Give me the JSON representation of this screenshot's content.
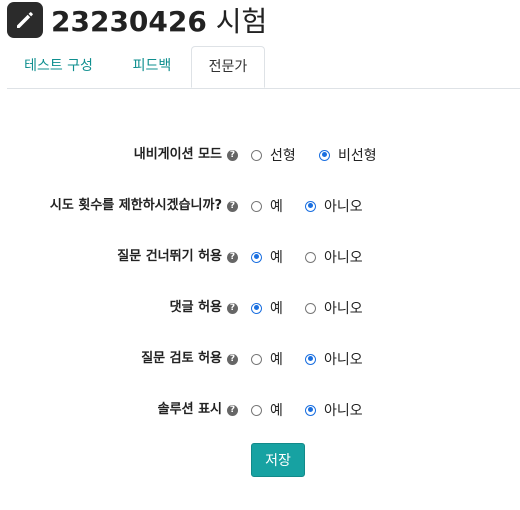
{
  "header": {
    "title_number": "23230426",
    "title_suffix": "시험"
  },
  "tabs": [
    {
      "label": "테스트 구성",
      "active": false
    },
    {
      "label": "피드백",
      "active": false
    },
    {
      "label": "전문가",
      "active": true
    }
  ],
  "help_glyph": "?",
  "settings": [
    {
      "label": "내비게이션 모드",
      "options": [
        {
          "label": "선형",
          "checked": false
        },
        {
          "label": "비선형",
          "checked": true
        }
      ]
    },
    {
      "label": "시도 횟수를 제한하시겠습니까?",
      "options": [
        {
          "label": "예",
          "checked": false
        },
        {
          "label": "아니오",
          "checked": true
        }
      ]
    },
    {
      "label": "질문 건너뛰기 허용",
      "options": [
        {
          "label": "예",
          "checked": true
        },
        {
          "label": "아니오",
          "checked": false
        }
      ]
    },
    {
      "label": "댓글 허용",
      "options": [
        {
          "label": "예",
          "checked": true
        },
        {
          "label": "아니오",
          "checked": false
        }
      ]
    },
    {
      "label": "질문 검토 허용",
      "options": [
        {
          "label": "예",
          "checked": false
        },
        {
          "label": "아니오",
          "checked": true
        }
      ]
    },
    {
      "label": "솔루션 표시",
      "options": [
        {
          "label": "예",
          "checked": false
        },
        {
          "label": "아니오",
          "checked": true
        }
      ]
    }
  ],
  "save_label": "저장",
  "icons": {
    "title": "pencil-icon",
    "help": "question-circle-icon"
  },
  "colors": {
    "accent": "#17a2a2",
    "tab_text": "#0f8f8f",
    "radio_checked": "#1a6fe0"
  }
}
